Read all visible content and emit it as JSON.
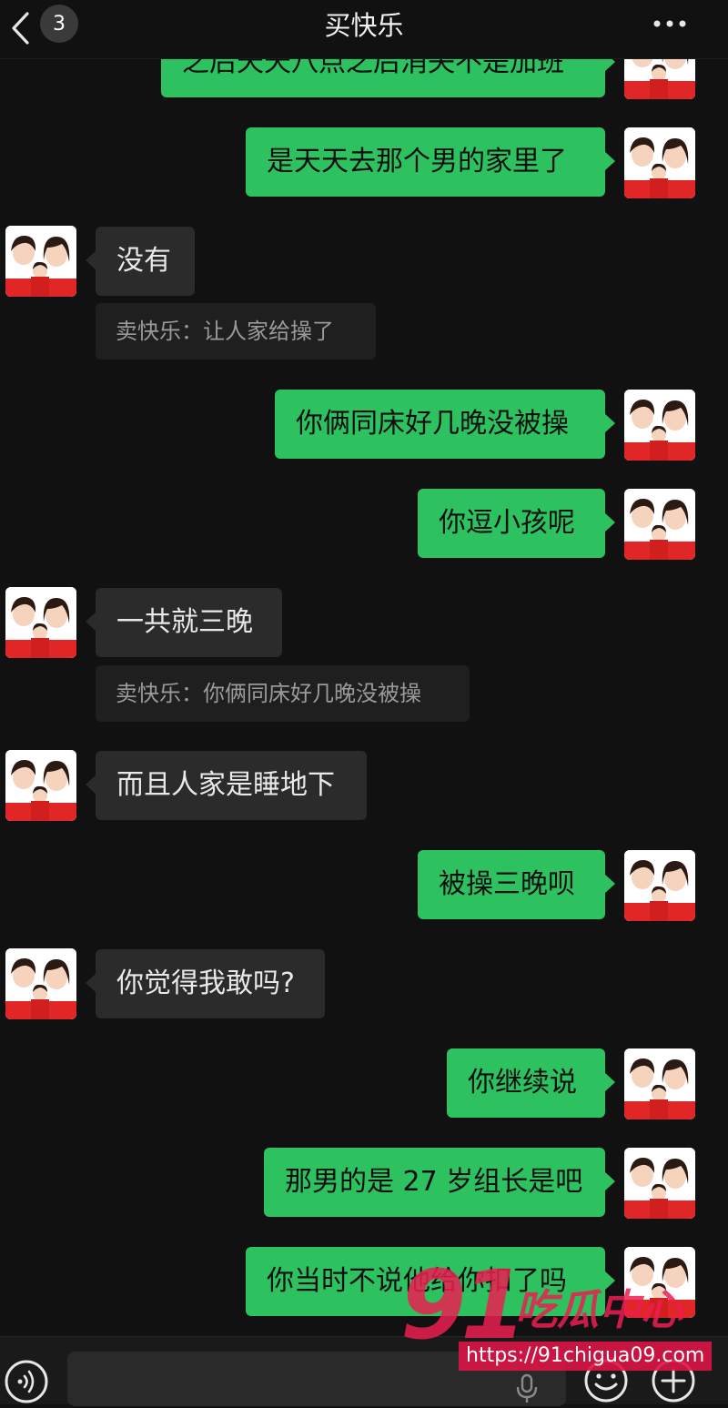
{
  "header": {
    "title": "买快乐",
    "unread_count": "3"
  },
  "colors": {
    "background": "#111111",
    "outgoing_bubble": "#2dc160",
    "incoming_bubble": "#2b2b2b",
    "quote_bg": "#1f1f1f"
  },
  "messages": [
    {
      "side": "out",
      "text": "之后天天八点之后消失不是加班"
    },
    {
      "side": "out",
      "text": "是天天去那个男的家里了"
    },
    {
      "side": "in",
      "text": "没有"
    },
    {
      "side": "quote",
      "text": "卖快乐：让人家给操了"
    },
    {
      "side": "out",
      "text": "你俩同床好几晚没被操"
    },
    {
      "side": "out",
      "text": "你逗小孩呢"
    },
    {
      "side": "in",
      "text": "一共就三晚"
    },
    {
      "side": "quote",
      "text": "卖快乐：你俩同床好几晚没被操"
    },
    {
      "side": "in",
      "text": "而且人家是睡地下"
    },
    {
      "side": "out",
      "text": "被操三晚呗"
    },
    {
      "side": "in",
      "text": "你觉得我敢吗?"
    },
    {
      "side": "out",
      "text": "你继续说"
    },
    {
      "side": "out",
      "text": "那男的是 27 岁组长是吧"
    },
    {
      "side": "out",
      "text": "你当时不说他给你扣了吗"
    }
  ],
  "watermark": {
    "number": "91",
    "brand": "吃瓜中心",
    "url": "https://91chigua09.com"
  },
  "icons": {
    "back": "chevron-left-icon",
    "more": "more-dots-icon",
    "voice": "voice-icon",
    "mic": "mic-icon",
    "emoji": "emoji-icon",
    "plus": "plus-icon"
  }
}
